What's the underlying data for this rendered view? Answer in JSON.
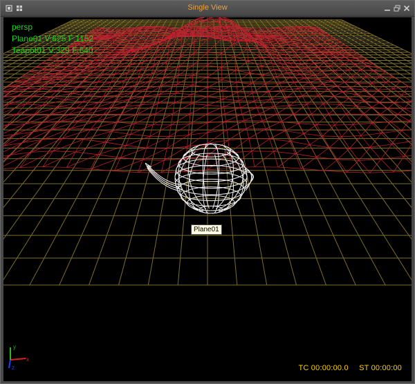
{
  "window": {
    "title": "Single View"
  },
  "hud": {
    "view_name": "persp",
    "objects": [
      {
        "label": "Plane01 V:625 F:1152"
      },
      {
        "label": "Teapot01 V:329 F:640"
      }
    ]
  },
  "tooltip": {
    "label": "Plane01"
  },
  "status": {
    "tc": "TC 00:00:00.0",
    "st": "ST 00:00:00"
  },
  "axes": {
    "x_label": "x",
    "y_label": "y",
    "z_label": "z"
  },
  "colors": {
    "title": "#f0a030",
    "hud_text": "#19d819",
    "grid": "#8a7a30",
    "mesh": "#c02030",
    "teapot": "#ffffff",
    "timecode": "#ffd000"
  }
}
